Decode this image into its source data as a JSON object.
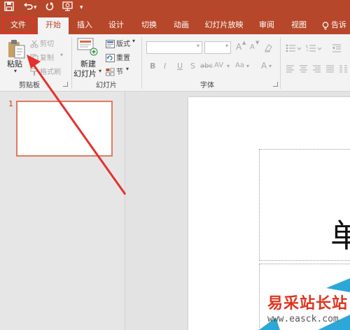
{
  "tabs": [
    "文件",
    "开始",
    "插入",
    "设计",
    "切换",
    "动画",
    "幻灯片放映",
    "审阅",
    "视图",
    "告诉"
  ],
  "clipboard": {
    "paste": "粘贴",
    "cut": "剪切",
    "copy": "复制",
    "format_painter": "格式刷",
    "group_label": "剪贴板"
  },
  "slides_group": {
    "new_slide_line1": "新建",
    "new_slide_line2": "幻灯片",
    "layout": "版式",
    "reset": "重置",
    "section": "节",
    "group_label": "幻灯片"
  },
  "font_group": {
    "bold": "B",
    "italic": "I",
    "underline": "U",
    "shadow": "S",
    "strikethrough": "abc",
    "spacing": "AV",
    "case": "Aa",
    "color": "A",
    "grow": "A",
    "shrink": "A",
    "group_label": "字体"
  },
  "slide_panel": {
    "number": "1"
  },
  "slide": {
    "title_char": "单"
  },
  "watermark": {
    "text": "易采站长站",
    "url": "www.easck.com"
  },
  "colors": {
    "accent": "#b7472a",
    "highlight": "#e5312b"
  }
}
